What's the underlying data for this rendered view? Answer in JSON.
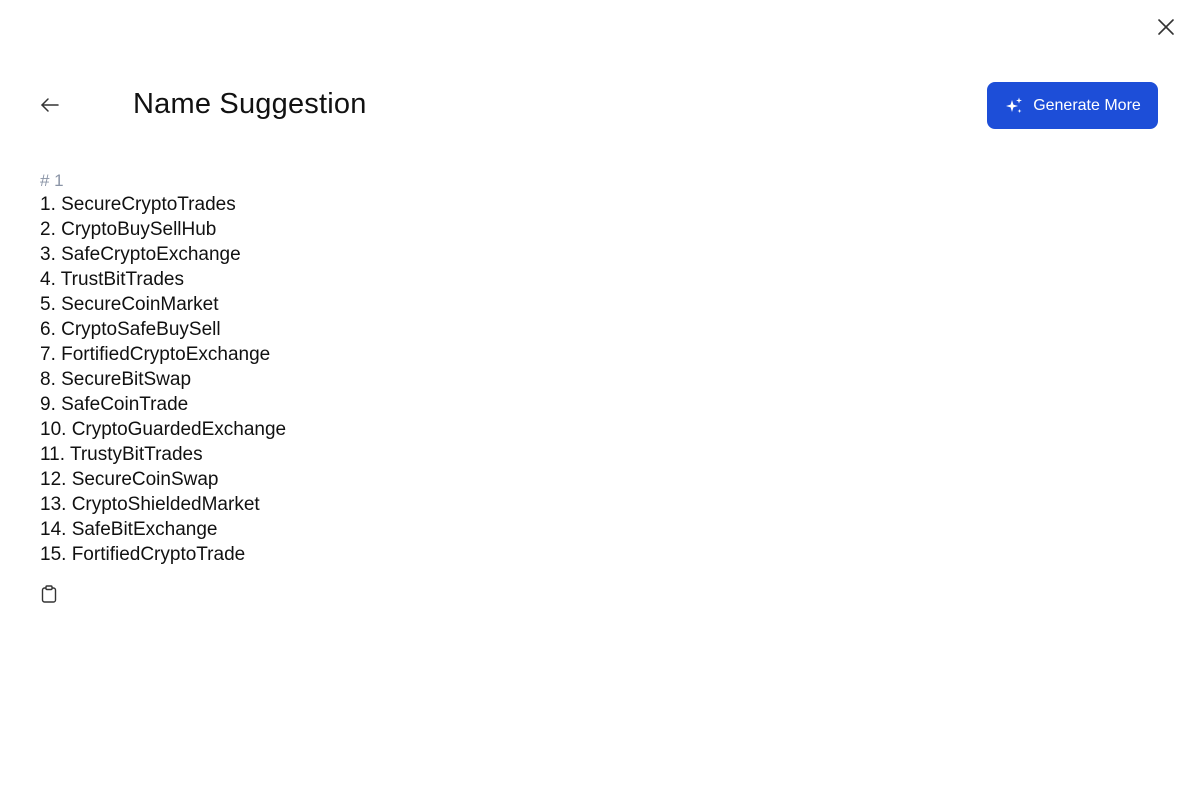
{
  "header": {
    "title": "Name Suggestion",
    "generate_more_label": "Generate More",
    "icons": {
      "close": "close-icon",
      "back": "arrow-left-icon",
      "generate": "sparkles-icon"
    }
  },
  "result": {
    "heading": "# 1",
    "items": [
      "1. SecureCryptoTrades",
      "2. CryptoBuySellHub",
      "3. SafeCryptoExchange",
      "4. TrustBitTrades",
      "5. SecureCoinMarket",
      "6. CryptoSafeBuySell",
      "7. FortifiedCryptoExchange",
      "8. SecureBitSwap",
      "9. SafeCoinTrade",
      "10. CryptoGuardedExchange",
      "11. TrustyBitTrades",
      "12. SecureCoinSwap",
      "13. CryptoShieldedMarket",
      "14. SafeBitExchange",
      "15. FortifiedCryptoTrade"
    ],
    "copy_icon": "clipboard-icon"
  },
  "colors": {
    "accent": "#1d4ed8",
    "heading_muted": "#8a94a6",
    "text": "#111111",
    "background": "#ffffff"
  }
}
